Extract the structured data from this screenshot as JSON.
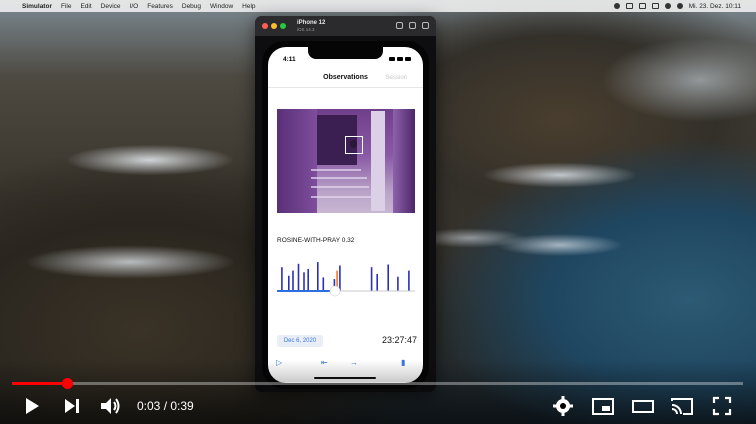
{
  "menubar": {
    "items": [
      "Simulator",
      "File",
      "Edit",
      "Device",
      "I/O",
      "Features",
      "Debug",
      "Window",
      "Help"
    ],
    "date_time": "Mi. 23. Dez. 10:11"
  },
  "simulator": {
    "device_name": "iPhone 12",
    "os_version": "iOS 14.3"
  },
  "phone": {
    "status_time": "4:11",
    "nav_title": "Observations",
    "nav_right_label": "Session",
    "detection_label": "ROSINE-WITH-PRAY 0.32",
    "date_button": "Dec 6, 2020",
    "time_value": "23:27:47",
    "timeline_value_fraction": 0.42
  },
  "chart_data": {
    "type": "bar",
    "title": "",
    "xlabel": "",
    "ylabel": "",
    "colors": {
      "normal": "#2b2fb8",
      "highlight": "#f07a1e",
      "track": "#2b6fe0"
    },
    "series": [
      {
        "values": [
          {
            "x": 0.03,
            "h": 0.7
          },
          {
            "x": 0.08,
            "h": 0.45
          },
          {
            "x": 0.11,
            "h": 0.6
          },
          {
            "x": 0.15,
            "h": 0.8
          },
          {
            "x": 0.19,
            "h": 0.55
          },
          {
            "x": 0.22,
            "h": 0.65
          },
          {
            "x": 0.29,
            "h": 0.85
          },
          {
            "x": 0.33,
            "h": 0.4
          },
          {
            "x": 0.41,
            "h": 0.35
          },
          {
            "x": 0.45,
            "h": 0.75
          },
          {
            "x": 0.68,
            "h": 0.7
          },
          {
            "x": 0.72,
            "h": 0.5
          },
          {
            "x": 0.8,
            "h": 0.78
          },
          {
            "x": 0.87,
            "h": 0.42
          },
          {
            "x": 0.95,
            "h": 0.6
          }
        ]
      },
      {
        "values": [
          {
            "x": 0.43,
            "h": 0.6
          }
        ]
      }
    ]
  },
  "player": {
    "current_time": "0:03 / 0:39",
    "progress_fraction": 0.075,
    "colors": {
      "accent": "#ff0000"
    }
  }
}
